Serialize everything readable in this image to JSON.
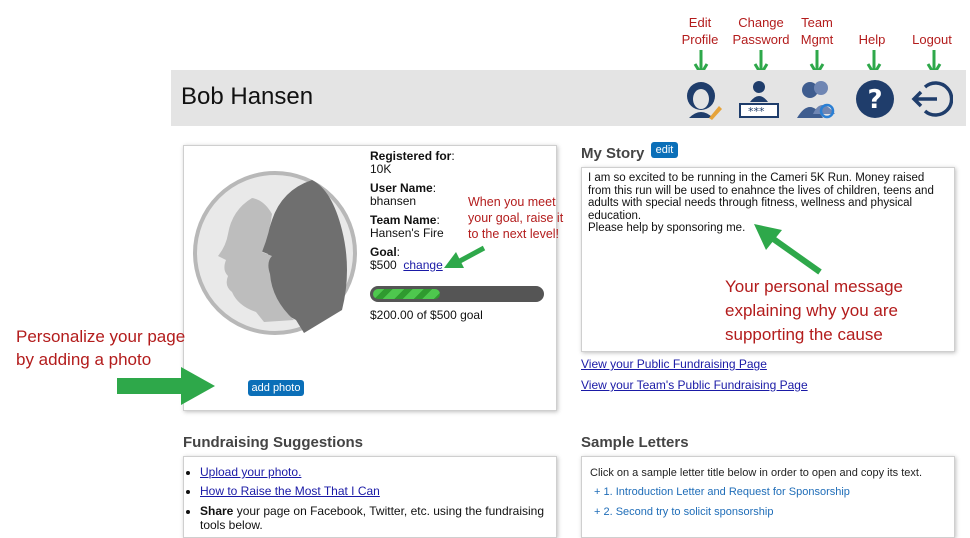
{
  "top_labels": {
    "edit_profile_1": "Edit",
    "edit_profile_2": "Profile",
    "change_password_1": "Change",
    "change_password_2": "Password",
    "team_mgmt_1": "Team",
    "team_mgmt_2": "Mgmt",
    "help": "Help",
    "logout": "Logout"
  },
  "header": {
    "name": "Bob Hansen"
  },
  "icons": [
    "edit-profile-icon",
    "change-password-icon",
    "team-management-icon",
    "help-icon",
    "logout-icon"
  ],
  "profile": {
    "registered_label": "Registered for",
    "registered_value": "10K",
    "username_label": "User Name",
    "username_value": "bhansen",
    "team_label": "Team Name",
    "team_value": "Hansen's Fire",
    "goal_label": "Goal",
    "goal_value": "$500",
    "change_link": "change",
    "progress_fraction": 0.4,
    "progress_text": "$200.00 of $500 goal",
    "add_photo": "add photo"
  },
  "annotations": {
    "goal_1": "When you meet",
    "goal_2": "your goal, raise it",
    "goal_3": "to the next level!",
    "photo_1": "Personalize your page",
    "photo_2": "by adding a photo",
    "message_1": "Your personal message",
    "message_2": "explaining why you are",
    "message_3": "supporting the cause"
  },
  "story": {
    "title": "My Story",
    "edit": "edit",
    "text": "I am so excited to be running in the Cameri 5K Run.  Money raised from this run will be used to enahnce the lives of children, teens and adults with special needs through fitness, wellness and physical education.\nPlease help by sponsoring me.",
    "public_link": "View your Public Fundraising Page",
    "team_link": "View your Team's Public Fundraising Page"
  },
  "fundraising": {
    "title": "Fundraising Suggestions",
    "item1": "Upload your photo.",
    "item2": "How to Raise the Most That I Can",
    "item3_bold": "Share",
    "item3_rest": " your page on Facebook, Twitter, etc. using the fundraising tools below."
  },
  "letters": {
    "title": "Sample Letters",
    "intro": "Click on a sample letter title below in order to open and copy its text.",
    "l1": "+ 1. Introduction Letter and Request for Sponsorship",
    "l2": "+ 2. Second try to solicit sponsorship"
  },
  "colors": {
    "annotation_red": "#b31c1c",
    "arrow_green": "#2ea84a",
    "icon_navy": "#1f3d6b",
    "button_blue": "#0b6fb8"
  }
}
